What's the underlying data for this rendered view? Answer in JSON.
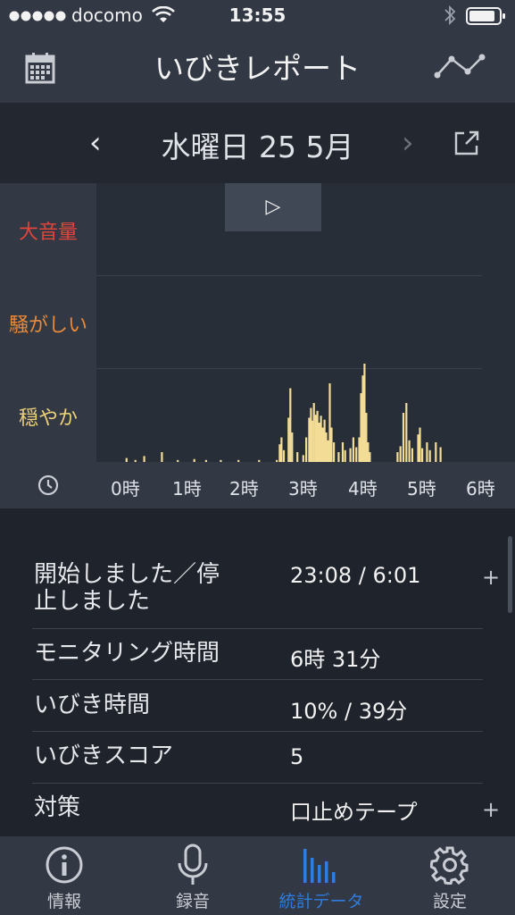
{
  "status": {
    "carrier": "docomo",
    "time": "13:55"
  },
  "nav": {
    "title": "いびきレポート",
    "calendar_icon": "calendar-icon",
    "trend_icon": "trend-icon"
  },
  "date_bar": {
    "date": "水曜日 25 5月",
    "prev": "‹",
    "next": "›",
    "play": "▷"
  },
  "chart": {
    "y_labels": {
      "loud": "大音量",
      "noisy": "騒がしい",
      "quiet": "穏やか"
    },
    "loud_color": "#e0453a",
    "noisy_color": "#e8893a",
    "quiet_color": "#eed27a",
    "bar_color": "#f2dc96"
  },
  "chart_data": {
    "type": "bar",
    "x_ticks": [
      "0時",
      "1時",
      "2時",
      "3時",
      "4時",
      "5時",
      "6時"
    ],
    "y_categories": [
      "穏やか",
      "騒がしい",
      "大音量"
    ],
    "series": [
      {
        "values": [
          [
            -0.05,
            0.04
          ],
          [
            0.1,
            0.02
          ],
          [
            0.25,
            0.06
          ],
          [
            0.55,
            0.1
          ],
          [
            0.82,
            0.02
          ],
          [
            1.1,
            0.03
          ],
          [
            1.3,
            0.02
          ],
          [
            1.55,
            0.02
          ],
          [
            1.85,
            0.02
          ],
          [
            2.2,
            0.02
          ],
          [
            2.5,
            0.02
          ],
          [
            2.55,
            0.18
          ],
          [
            2.58,
            0.25
          ],
          [
            2.62,
            0.12
          ],
          [
            2.7,
            0.45
          ],
          [
            2.73,
            0.75
          ],
          [
            2.76,
            0.3
          ],
          [
            2.85,
            0.1
          ],
          [
            2.95,
            0.07
          ],
          [
            3.0,
            0.25
          ],
          [
            3.05,
            0.45
          ],
          [
            3.08,
            0.55
          ],
          [
            3.1,
            0.42
          ],
          [
            3.13,
            0.6
          ],
          [
            3.16,
            0.48
          ],
          [
            3.19,
            0.52
          ],
          [
            3.22,
            0.4
          ],
          [
            3.25,
            0.47
          ],
          [
            3.28,
            0.35
          ],
          [
            3.31,
            0.43
          ],
          [
            3.34,
            0.3
          ],
          [
            3.37,
            0.22
          ],
          [
            3.4,
            0.8
          ],
          [
            3.43,
            0.35
          ],
          [
            3.47,
            0.2
          ],
          [
            3.55,
            0.1
          ],
          [
            3.62,
            0.2
          ],
          [
            3.66,
            0.12
          ],
          [
            3.75,
            0.14
          ],
          [
            3.8,
            0.25
          ],
          [
            3.85,
            0.15
          ],
          [
            3.9,
            0.25
          ],
          [
            3.93,
            0.7
          ],
          [
            3.96,
            0.88
          ],
          [
            3.99,
            1.0
          ],
          [
            4.02,
            0.5
          ],
          [
            4.05,
            0.2
          ],
          [
            4.08,
            0.1
          ],
          [
            4.55,
            0.1
          ],
          [
            4.6,
            0.16
          ],
          [
            4.65,
            0.5
          ],
          [
            4.7,
            0.6
          ],
          [
            4.75,
            0.22
          ],
          [
            4.8,
            0.14
          ],
          [
            4.9,
            0.28
          ],
          [
            4.93,
            0.35
          ],
          [
            4.97,
            0.14
          ],
          [
            5.05,
            0.2
          ],
          [
            5.1,
            0.12
          ],
          [
            5.2,
            0.2
          ],
          [
            5.28,
            0.15
          ]
        ]
      }
    ]
  },
  "stats": [
    {
      "label_line1": "開始しました／停",
      "label_line2": "止しました",
      "value": "23:08 / 6:01",
      "plus": "+"
    },
    {
      "label": "モニタリング時間",
      "value": "6時 31分"
    },
    {
      "label": "いびき時間",
      "value": "10% / 39分"
    },
    {
      "label": "いびきスコア",
      "value": "5"
    },
    {
      "label": "対策",
      "value": "口止めテープ",
      "plus": "+"
    }
  ],
  "tabs": [
    {
      "label": "情報",
      "icon": "info-icon",
      "active": false
    },
    {
      "label": "録音",
      "icon": "microphone-icon",
      "active": false
    },
    {
      "label": "統計データ",
      "icon": "stats-icon",
      "active": true
    },
    {
      "label": "設定",
      "icon": "gear-icon",
      "active": false
    }
  ],
  "colors": {
    "active_tab": "#2f7de0",
    "inactive_tab": "#c9ccd2",
    "header": "#323844"
  }
}
